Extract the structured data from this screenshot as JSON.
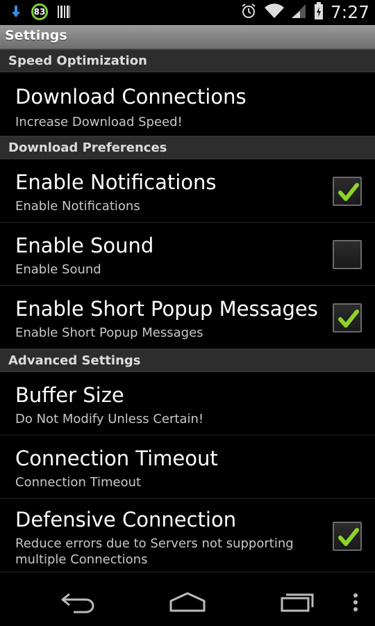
{
  "status_bar": {
    "battery_level": "83",
    "time": "7:27",
    "icons": [
      "download-icon",
      "battery-circle-icon",
      "barcode-icon",
      "alarm-icon",
      "wifi-icon",
      "signal-icon",
      "battery-icon"
    ]
  },
  "action_bar": {
    "title": "Settings"
  },
  "sections": {
    "speed": {
      "header": "Speed Optimization"
    },
    "download_prefs": {
      "header": "Download Preferences"
    },
    "advanced": {
      "header": "Advanced Settings"
    }
  },
  "prefs": {
    "download_connections": {
      "title": "Download Connections",
      "summary": "Increase Download Speed!"
    },
    "enable_notifications": {
      "title": "Enable Notifications",
      "summary": "Enable Notifications",
      "checked": true
    },
    "enable_sound": {
      "title": "Enable Sound",
      "summary": "Enable Sound",
      "checked": false
    },
    "enable_popups": {
      "title": "Enable Short Popup Messages",
      "summary": "Enable Short Popup Messages",
      "checked": true
    },
    "buffer_size": {
      "title": "Buffer Size",
      "summary": "Do Not Modify Unless Certain!"
    },
    "connection_timeout": {
      "title": "Connection Timeout",
      "summary": "Connection Timeout"
    },
    "defensive_connection": {
      "title": "Defensive Connection",
      "summary": "Reduce errors due to Servers not supporting multiple Connections",
      "checked": true
    }
  },
  "colors": {
    "check_green": "#8fd32a",
    "category_bg": "#2d2d2d",
    "actionbar_bg": "#8a8a8a"
  },
  "nav_bar": {
    "icons": [
      "back-icon",
      "home-icon",
      "recents-icon",
      "overflow-menu-icon"
    ]
  }
}
